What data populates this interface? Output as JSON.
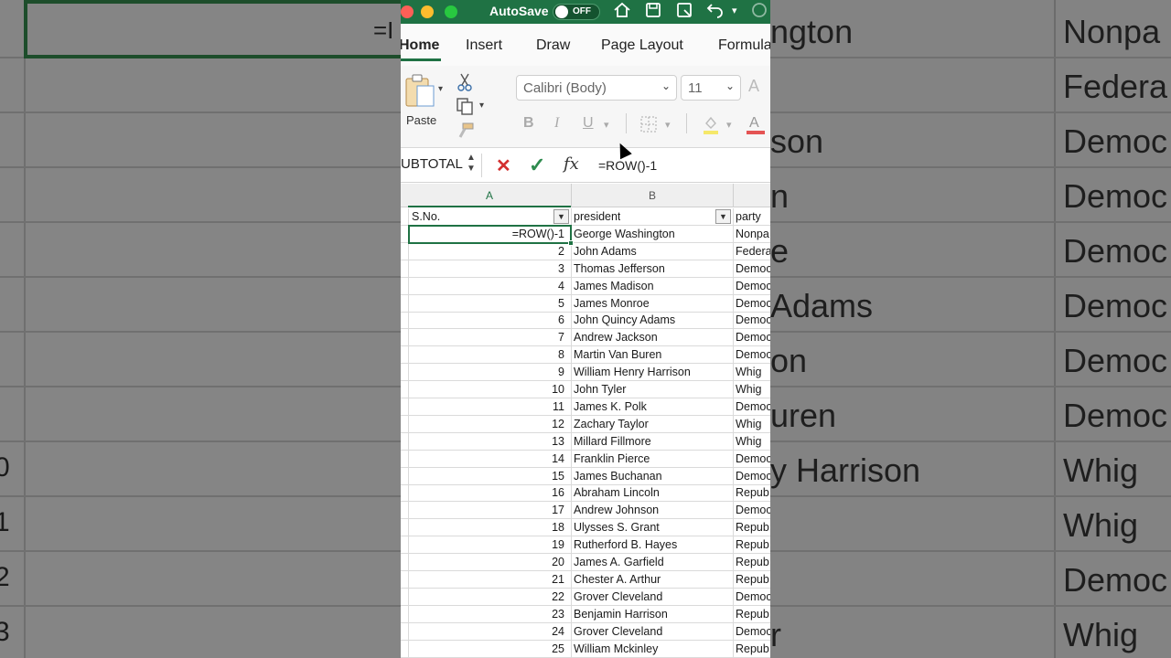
{
  "titlebar": {
    "autosave_label": "AutoSave",
    "autosave_state": "OFF",
    "icons": [
      "home-icon",
      "save-icon",
      "save-as-icon",
      "undo-icon",
      "redo-icon"
    ]
  },
  "tabs": [
    "Home",
    "Insert",
    "Draw",
    "Page Layout",
    "Formula"
  ],
  "active_tab": "Home",
  "ribbon": {
    "paste_label": "Paste",
    "font_name": "Calibri (Body)",
    "font_size": "11",
    "bold": "B",
    "italic": "I",
    "underline": "U"
  },
  "formula_bar": {
    "name_box": "UBTOTAL",
    "formula": "=ROW()-1"
  },
  "columns": [
    "A",
    "B"
  ],
  "headers": [
    "S.No.",
    "president",
    "party"
  ],
  "rows": [
    {
      "a": "=ROW()-1",
      "b": "George Washington",
      "c": "Nonpa"
    },
    {
      "a": "2",
      "b": "John Adams",
      "c": "Federa"
    },
    {
      "a": "3",
      "b": "Thomas Jefferson",
      "c": "Democ"
    },
    {
      "a": "4",
      "b": "James Madison",
      "c": "Democ"
    },
    {
      "a": "5",
      "b": "James Monroe",
      "c": "Democ"
    },
    {
      "a": "6",
      "b": "John Quincy Adams",
      "c": "Democ"
    },
    {
      "a": "7",
      "b": "Andrew Jackson",
      "c": "Democ"
    },
    {
      "a": "8",
      "b": "Martin Van Buren",
      "c": "Democ"
    },
    {
      "a": "9",
      "b": "William Henry Harrison",
      "c": "Whig"
    },
    {
      "a": "10",
      "b": "John Tyler",
      "c": "Whig"
    },
    {
      "a": "11",
      "b": "James K. Polk",
      "c": "Democ"
    },
    {
      "a": "12",
      "b": "Zachary Taylor",
      "c": "Whig"
    },
    {
      "a": "13",
      "b": "Millard Fillmore",
      "c": "Whig"
    },
    {
      "a": "14",
      "b": "Franklin Pierce",
      "c": "Democ"
    },
    {
      "a": "15",
      "b": "James Buchanan",
      "c": "Democ"
    },
    {
      "a": "16",
      "b": "Abraham Lincoln",
      "c": "Repub"
    },
    {
      "a": "17",
      "b": "Andrew Johnson",
      "c": "Democ"
    },
    {
      "a": "18",
      "b": "Ulysses S. Grant",
      "c": "Repub"
    },
    {
      "a": "19",
      "b": "Rutherford B. Hayes",
      "c": "Repub"
    },
    {
      "a": "20",
      "b": "James A. Garfield",
      "c": "Repub"
    },
    {
      "a": "21",
      "b": "Chester A. Arthur",
      "c": "Repub"
    },
    {
      "a": "22",
      "b": "Grover Cleveland",
      "c": "Democ"
    },
    {
      "a": "23",
      "b": "Benjamin Harrison",
      "c": "Repub"
    },
    {
      "a": "24",
      "b": "Grover Cleveland",
      "c": "Democ"
    },
    {
      "a": "25",
      "b": "William Mckinley",
      "c": "Repub"
    }
  ],
  "background": {
    "left_formula": "=I",
    "left_rownums": [
      "0",
      "1",
      "2",
      "3"
    ],
    "right_col1": [
      "ngton",
      "",
      "son",
      "n",
      "e",
      "Adams",
      "on",
      "uren",
      "y Harrison",
      "",
      "",
      "r"
    ],
    "right_col2": [
      "Nonpa",
      "Federa",
      "Democ",
      "Democ",
      "Democ",
      "Democ",
      "Democ",
      "Democ",
      "Whig",
      "Whig",
      "Democ",
      "Whig"
    ]
  },
  "colors": {
    "excel_green": "#1f7244",
    "cancel_red": "#d32f2f",
    "confirm_green": "#2e8b4e"
  }
}
